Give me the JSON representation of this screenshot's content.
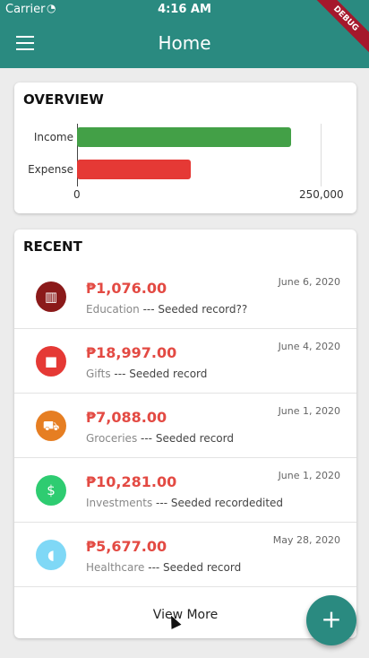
{
  "status": {
    "carrier": "Carrier",
    "time": "4:16 AM"
  },
  "debug_banner": "DEBUG",
  "appbar": {
    "title": "Home"
  },
  "overview": {
    "title": "OVERVIEW",
    "chart_data": {
      "type": "bar",
      "orientation": "horizontal",
      "categories": [
        "Income",
        "Expense"
      ],
      "values": [
        220000,
        117000
      ],
      "colors": [
        "#43a047",
        "#e53935"
      ],
      "xlim": [
        0,
        250000
      ],
      "tick_labels": [
        "0",
        "250,000"
      ]
    }
  },
  "recent": {
    "title": "RECENT",
    "items": [
      {
        "amount": "₱1,076.00",
        "category": "Education",
        "separator": " --- ",
        "note": "Seeded record??",
        "date": "June 6, 2020",
        "icon": "bank-icon",
        "color": "#8b1a1a"
      },
      {
        "amount": "₱18,997.00",
        "category": "Gifts",
        "separator": " --- ",
        "note": "Seeded record",
        "date": "June 4, 2020",
        "icon": "gift-icon",
        "color": "#e53935"
      },
      {
        "amount": "₱7,088.00",
        "category": "Groceries",
        "separator": " --- ",
        "note": "Seeded record",
        "date": "June 1, 2020",
        "icon": "cart-icon",
        "color": "#e67e22"
      },
      {
        "amount": "₱10,281.00",
        "category": "Investments",
        "separator": " --- ",
        "note": "Seeded recordedited",
        "date": "June 1, 2020",
        "icon": "money-icon",
        "color": "#2ecc71"
      },
      {
        "amount": "₱5,677.00",
        "category": "Healthcare",
        "separator": " --- ",
        "note": "Seeded record",
        "date": "May 28, 2020",
        "icon": "pill-icon",
        "color": "#7fd8f6"
      }
    ],
    "view_more": "View More"
  },
  "fab": {
    "label": "+"
  }
}
